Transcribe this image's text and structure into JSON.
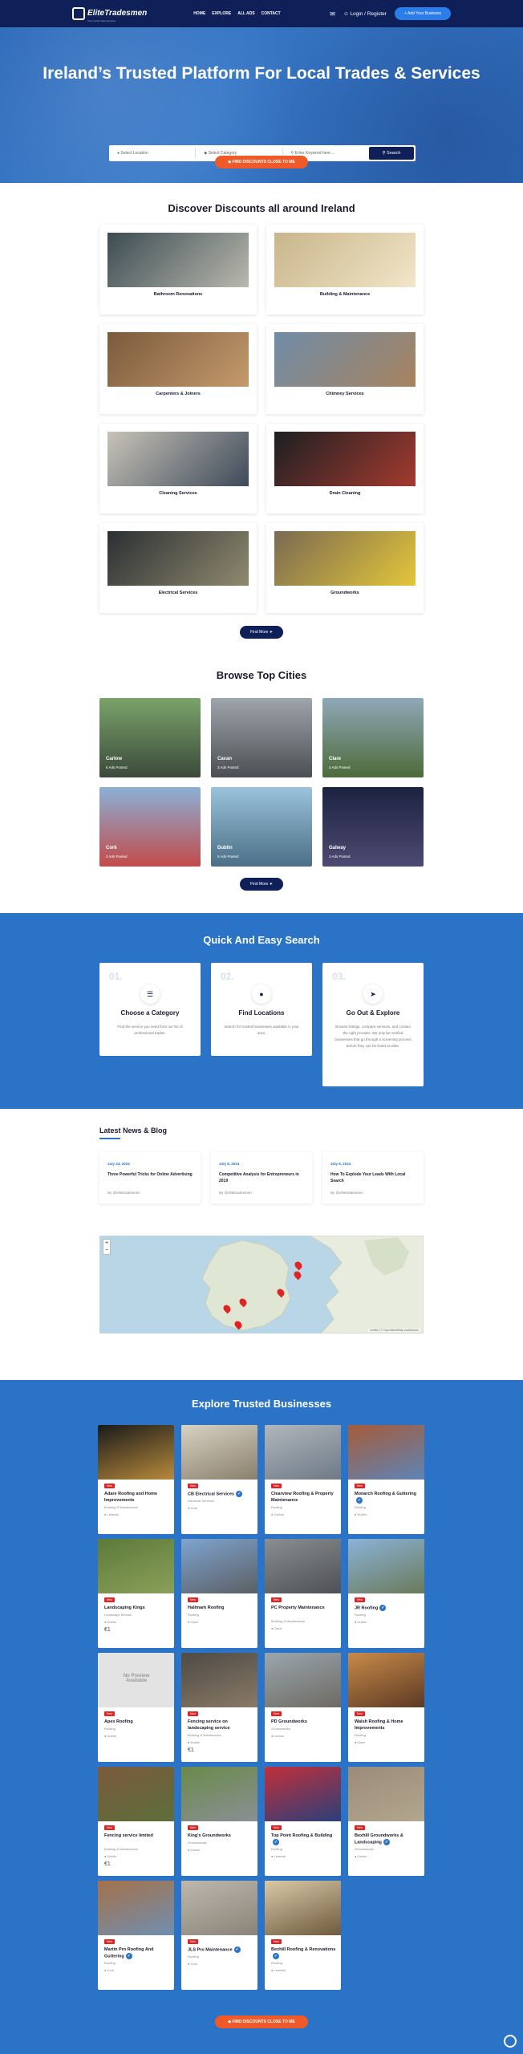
{
  "header": {
    "logo_text": "EliteTradesmen",
    "logo_tagline": "Your Local Trade Services",
    "nav": [
      "HOME",
      "EXPLORE",
      "ALL ADS",
      "CONTACT"
    ],
    "login": "Login / Register",
    "add_button": "Add Your Business"
  },
  "hero": {
    "title": "Ireland’s Trusted Platform For Local Trades & Services",
    "location_placeholder": "Select Location",
    "category_placeholder": "Select Category",
    "keyword_placeholder": "Enter Keyword here ...",
    "search_label": "Search",
    "cta": "FIND DISCOUNTS CLOSE TO ME"
  },
  "discounts": {
    "title": "Discover Discounts all around Ireland",
    "categories": [
      {
        "label": "Bathroom Renovations",
        "colors": [
          "#3c4c52",
          "#b9b8ae"
        ]
      },
      {
        "label": "Building & Maintenance",
        "colors": [
          "#c9b58b",
          "#f1e6c8"
        ]
      },
      {
        "label": "Carpenters & Joiners",
        "colors": [
          "#7b5a3c",
          "#c49a6c"
        ]
      },
      {
        "label": "Chimney Services",
        "colors": [
          "#6f8ca8",
          "#a8835f"
        ]
      },
      {
        "label": "Cleaning Services",
        "colors": [
          "#c8c3b8",
          "#3e4a5a"
        ]
      },
      {
        "label": "Drain Cleaning",
        "colors": [
          "#1c1f22",
          "#a43a2f"
        ]
      },
      {
        "label": "Electrical Services",
        "colors": [
          "#2b2f33",
          "#8f8a6e"
        ]
      },
      {
        "label": "Groundworks",
        "colors": [
          "#7a6a52",
          "#e3c63a"
        ]
      }
    ],
    "more": "Find More"
  },
  "cities": {
    "title": "Browse Top Cities",
    "items": [
      {
        "name": "Carlow",
        "ads": "5 Ads Posted",
        "colors": [
          "#7aa36a",
          "#3b4a3a"
        ]
      },
      {
        "name": "Cavan",
        "ads": "3 Ads Posted",
        "colors": [
          "#9ea5ab",
          "#4b4f53"
        ]
      },
      {
        "name": "Clare",
        "ads": "3 Ads Posted",
        "colors": [
          "#8fa8b8",
          "#4d6b3a"
        ]
      },
      {
        "name": "Cork",
        "ads": "3 Ads Posted",
        "colors": [
          "#8ab1d6",
          "#c24b4b"
        ]
      },
      {
        "name": "Dublin",
        "ads": "5 Ads Posted",
        "colors": [
          "#9bc3dc",
          "#4a6f86"
        ]
      },
      {
        "name": "Galway",
        "ads": "3 Ads Posted",
        "colors": [
          "#1b2340",
          "#4e4a72"
        ]
      }
    ],
    "more": "Find More"
  },
  "quick": {
    "title": "Quick And Easy Search",
    "steps": [
      {
        "num": "01.",
        "icon": "list-icon",
        "title": "Choose a Category",
        "desc": "Find the service you need from our list of professional trades."
      },
      {
        "num": "02.",
        "icon": "location-pin-icon",
        "title": "Find Locations",
        "desc": "Search for trusted businesses available in your area."
      },
      {
        "num": "03.",
        "icon": "navigation-arrow-icon",
        "title": "Go Out & Explore",
        "desc": "Browse listings, compare services, and contact the right provider. We only list verified businesses that go through a screening process before they can be listed as Elite."
      }
    ]
  },
  "blog": {
    "title": "Latest News & Blog",
    "posts": [
      {
        "date": "July 24, 2024",
        "title": "Three Powerful Tricks for Online Advertising",
        "by": "By @elitetradesmen"
      },
      {
        "date": "July 8, 2024",
        "title": "Competitive Analysis for Entrepreneurs in 2019",
        "by": "By @elitetradesmen"
      },
      {
        "date": "July 8, 2024",
        "title": "How To Explode Your Leads With Local Search",
        "by": "By @elitetradesmen"
      }
    ]
  },
  "map": {
    "attribution": "Leaflet | © OpenStreetMap contributors"
  },
  "businesses": {
    "title": "Explore Trusted Businesses",
    "badge": "New",
    "items": [
      {
        "name": "Adare Roofing and Home Improvements",
        "cat": "Building & Maintenance",
        "loc": "Limerick",
        "verified": false,
        "price": "",
        "colors": [
          "#1a1a1a",
          "#b88a3b"
        ]
      },
      {
        "name": "CB Electrical Services",
        "cat": "Electrical Services",
        "loc": "Cork",
        "verified": true,
        "price": "",
        "colors": [
          "#d8d2c4",
          "#8a7f6c"
        ]
      },
      {
        "name": "Clearview Roofing & Property Maintenance",
        "cat": "Roofing",
        "loc": "Carlow",
        "verified": false,
        "price": "",
        "colors": [
          "#b0b6bd",
          "#6e7a86"
        ]
      },
      {
        "name": "Monarch Roofing & Guttering",
        "cat": "Roofing",
        "loc": "Dublin",
        "verified": true,
        "price": "",
        "colors": [
          "#a65b3a",
          "#5d84b5"
        ]
      },
      {
        "name": "Landscaping Kings",
        "cat": "Landscape Service",
        "loc": "Dublin",
        "verified": false,
        "price": "€1",
        "colors": [
          "#5d7a3a",
          "#8aa05a"
        ]
      },
      {
        "name": "Hallmark Roofing",
        "cat": "Roofing",
        "loc": "Clare",
        "verified": false,
        "price": "",
        "colors": [
          "#7ea4cf",
          "#5b5f64"
        ]
      },
      {
        "name": "PC Property Maintenance",
        "cat": "Building & Maintenance",
        "loc": "Clare",
        "verified": false,
        "price": "",
        "colors": [
          "#8b8e91",
          "#4d5054"
        ]
      },
      {
        "name": "JR Roofing",
        "cat": "Roofing",
        "loc": "Dublin",
        "verified": true,
        "price": "",
        "colors": [
          "#8bb3d8",
          "#6a7a5a"
        ]
      },
      {
        "name": "Apex Roofing",
        "cat": "Roofing",
        "loc": "Dublin",
        "verified": false,
        "price": "",
        "no_preview": "No Preview Available",
        "colors": [
          "#e3e3e3",
          "#e3e3e3"
        ]
      },
      {
        "name": "Fencing service on landscaping service",
        "cat": "Building & Maintenance",
        "loc": "Dublin",
        "verified": false,
        "price": "€1",
        "colors": [
          "#4d4a45",
          "#8a7a66"
        ]
      },
      {
        "name": "PD Groundworks",
        "cat": "Groundworks",
        "loc": "Carlow",
        "verified": false,
        "price": "",
        "colors": [
          "#9aa6ae",
          "#6e6a62"
        ]
      },
      {
        "name": "Walsh Roofing & Home Improvements",
        "cat": "Roofing",
        "loc": "Clare",
        "verified": false,
        "price": "",
        "colors": [
          "#c98a48",
          "#5b3a24"
        ]
      },
      {
        "name": "Fencing service limited",
        "cat": "Building & Maintenance",
        "loc": "Dublin",
        "verified": false,
        "price": "€1",
        "colors": [
          "#7a5a3e",
          "#5d6e3a"
        ]
      },
      {
        "name": "King's Groundworks",
        "cat": "Groundworks",
        "loc": "Cavan",
        "verified": false,
        "price": "",
        "colors": [
          "#6a8a4a",
          "#8a8f94"
        ]
      },
      {
        "name": "Top Point Roofing & Building",
        "cat": "Roofing",
        "loc": "Limerick",
        "verified": true,
        "price": "",
        "colors": [
          "#c22f3a",
          "#2a3f7a"
        ]
      },
      {
        "name": "Bexhill Groundworks & Landscaping",
        "cat": "Groundworks",
        "loc": "Cavan",
        "verified": true,
        "price": "",
        "colors": [
          "#9a8c78",
          "#b3a68e"
        ]
      },
      {
        "name": "Martin Pro Roofing And Guttering",
        "cat": "Roofing",
        "loc": "Cork",
        "verified": true,
        "price": "",
        "colors": [
          "#a5714a",
          "#6f8fb0"
        ]
      },
      {
        "name": "JLS Pro Maintenance",
        "cat": "Roofing",
        "loc": "Cork",
        "verified": true,
        "price": "",
        "colors": [
          "#bdb8ae",
          "#8a8478"
        ]
      },
      {
        "name": "Bexhill Roofing & Renovations",
        "cat": "Roofing",
        "loc": "Limerick",
        "verified": true,
        "price": "",
        "colors": [
          "#d9c8a8",
          "#6e5a3e"
        ]
      }
    ],
    "cta": "FIND DISCOUNTS CLOSE TO ME"
  }
}
